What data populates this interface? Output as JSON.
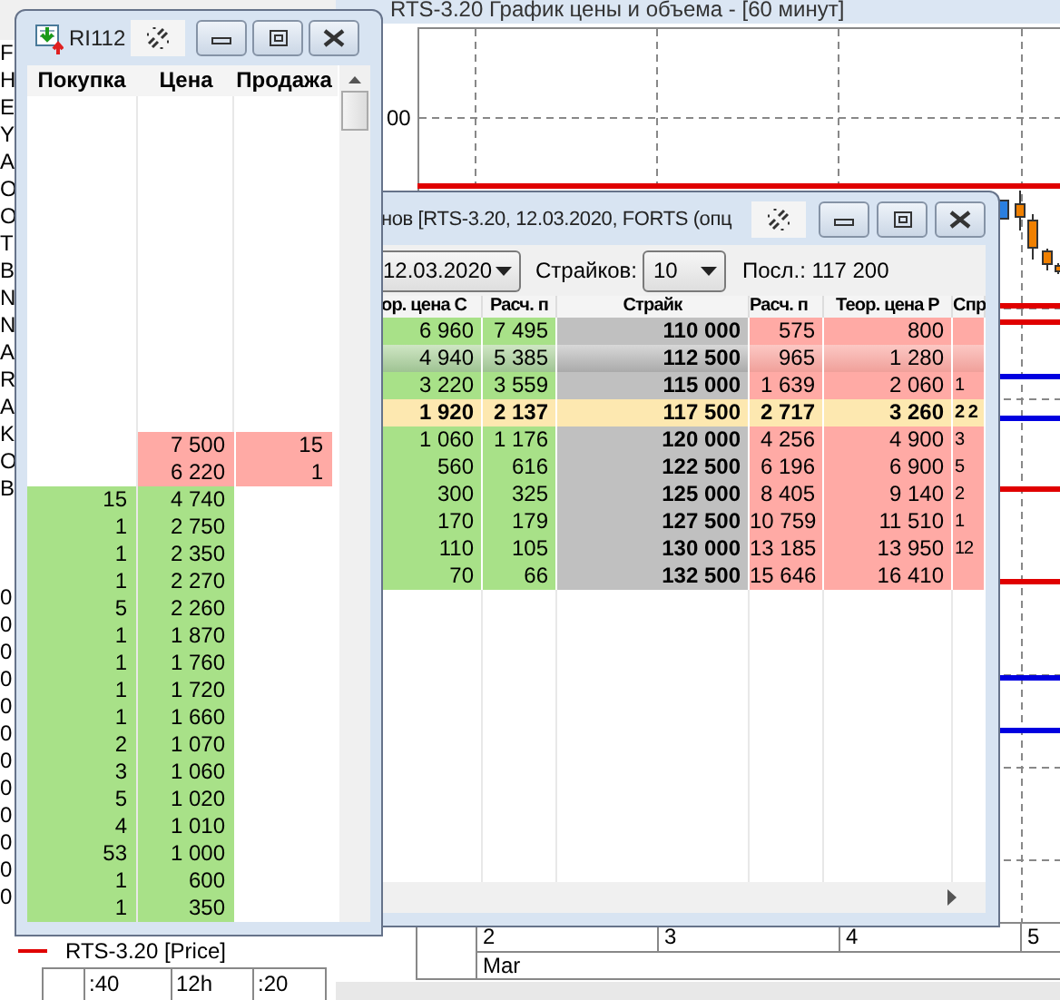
{
  "desktop": {
    "left_strip_letters": [
      "F",
      "H",
      "E",
      "Y",
      "A",
      "O",
      "O",
      "T",
      "B",
      "N",
      "N",
      "A",
      "R",
      "A",
      "K",
      "O",
      "B"
    ],
    "left_strip_values": [
      "0",
      "0",
      "0",
      "0",
      "0",
      "0",
      "0",
      "0",
      "0",
      "0",
      "0",
      "0"
    ],
    "lower_left_chart": {
      "legend": "RTS-3.20 [Price]",
      "time_ticks": [
        ":40",
        "12h",
        ":20"
      ]
    },
    "chart_window": {
      "title": "RTS-3.20 График цены и объема - [60 минут]",
      "y_tick": "00",
      "date_ticks": [
        "2",
        "3",
        "4",
        "5"
      ],
      "month": "Mar"
    }
  },
  "order_book": {
    "title": "RI112",
    "columns": [
      "Покупка",
      "Цена",
      "Продажа"
    ],
    "rows": [
      {
        "kind": "ask",
        "buy": "",
        "price": "7 500",
        "sell": "15"
      },
      {
        "kind": "ask",
        "buy": "",
        "price": "6 220",
        "sell": "1"
      },
      {
        "kind": "bid",
        "buy": "15",
        "price": "4 740",
        "sell": ""
      },
      {
        "kind": "bid",
        "buy": "1",
        "price": "2 750",
        "sell": ""
      },
      {
        "kind": "bid",
        "buy": "1",
        "price": "2 350",
        "sell": ""
      },
      {
        "kind": "bid",
        "buy": "1",
        "price": "2 270",
        "sell": ""
      },
      {
        "kind": "bid",
        "buy": "5",
        "price": "2 260",
        "sell": ""
      },
      {
        "kind": "bid",
        "buy": "1",
        "price": "1 870",
        "sell": ""
      },
      {
        "kind": "bid",
        "buy": "1",
        "price": "1 760",
        "sell": ""
      },
      {
        "kind": "bid",
        "buy": "1",
        "price": "1 720",
        "sell": ""
      },
      {
        "kind": "bid",
        "buy": "1",
        "price": "1 660",
        "sell": ""
      },
      {
        "kind": "bid",
        "buy": "2",
        "price": "1 070",
        "sell": ""
      },
      {
        "kind": "bid",
        "buy": "3",
        "price": "1 060",
        "sell": ""
      },
      {
        "kind": "bid",
        "buy": "5",
        "price": "1 020",
        "sell": ""
      },
      {
        "kind": "bid",
        "buy": "4",
        "price": "1 010",
        "sell": ""
      },
      {
        "kind": "bid",
        "buy": "53",
        "price": "1 000",
        "sell": ""
      },
      {
        "kind": "bid",
        "buy": "1",
        "price": "600",
        "sell": ""
      },
      {
        "kind": "bid",
        "buy": "1",
        "price": "350",
        "sell": ""
      }
    ]
  },
  "options_board": {
    "title": "нов [RTS-3.20, 12.03.2020, FORTS (опц",
    "date": "12.03.2020",
    "strikes_label": "Страйков:",
    "strikes": "10",
    "last": "Посл.: 117 200",
    "columns": [
      "ор. цена C",
      "Расч. п",
      "Страйк",
      "Расч. п",
      "Теор. цена P",
      "Спр"
    ],
    "rows": [
      {
        "kind": "strike",
        "selected": false,
        "cells": [
          "6 960",
          "7 495",
          "110 000",
          "575",
          "800",
          ""
        ]
      },
      {
        "kind": "strike",
        "selected": true,
        "cells": [
          "4 940",
          "5 385",
          "112 500",
          "965",
          "1 280",
          ""
        ]
      },
      {
        "kind": "strike",
        "selected": false,
        "cells": [
          "3 220",
          "3 559",
          "115 000",
          "1 639",
          "2 060",
          "1"
        ]
      },
      {
        "kind": "central",
        "selected": false,
        "cells": [
          "1 920",
          "2 137",
          "117 500",
          "2 717",
          "3 260",
          "2 2"
        ]
      },
      {
        "kind": "strike",
        "selected": false,
        "cells": [
          "1 060",
          "1 176",
          "120 000",
          "4 256",
          "4 900",
          "3"
        ]
      },
      {
        "kind": "strike",
        "selected": false,
        "cells": [
          "560",
          "616",
          "122 500",
          "6 196",
          "6 900",
          "5"
        ]
      },
      {
        "kind": "strike",
        "selected": false,
        "cells": [
          "300",
          "325",
          "125 000",
          "8 405",
          "9 140",
          "2"
        ]
      },
      {
        "kind": "strike",
        "selected": false,
        "cells": [
          "170",
          "179",
          "127 500",
          "10 759",
          "11 510",
          "1"
        ]
      },
      {
        "kind": "strike",
        "selected": false,
        "cells": [
          "110",
          "105",
          "130 000",
          "13 185",
          "13 950",
          "12"
        ]
      },
      {
        "kind": "strike",
        "selected": false,
        "cells": [
          "70",
          "66",
          "132 500",
          "15 646",
          "16 410",
          ""
        ]
      }
    ]
  }
}
